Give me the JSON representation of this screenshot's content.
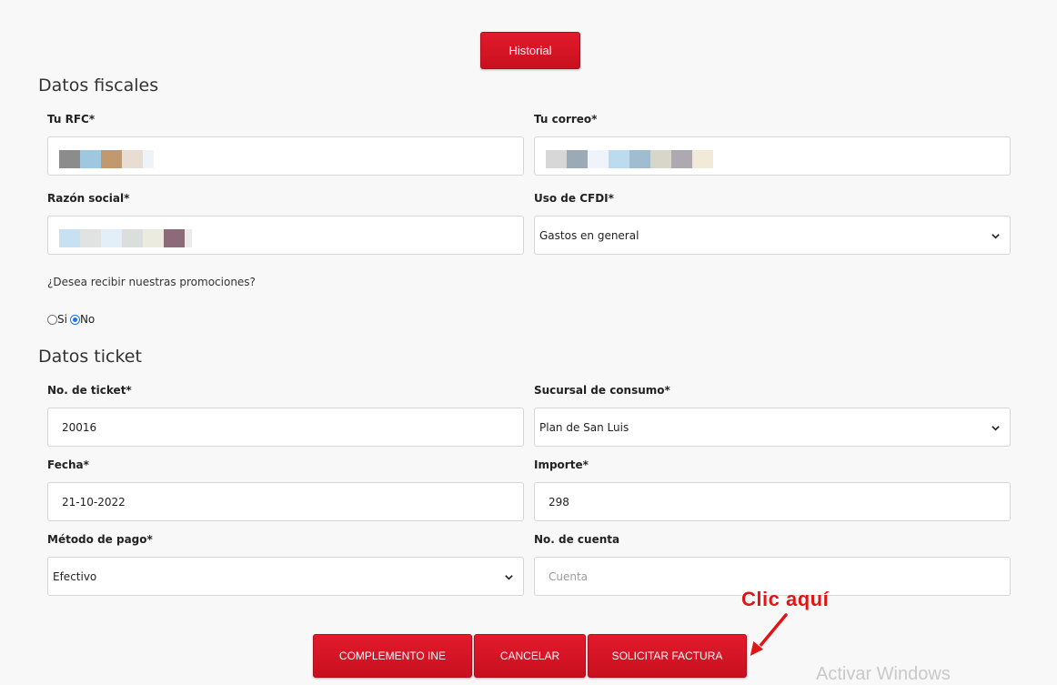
{
  "header": {
    "history_button": "Historial"
  },
  "fiscal": {
    "section_title": "Datos fiscales",
    "rfc": {
      "label": "Tu RFC*"
    },
    "email": {
      "label": "Tu correo*"
    },
    "razon": {
      "label": "Razón social*"
    },
    "cfdi": {
      "label": "Uso de CFDI*",
      "value": "Gastos en general"
    },
    "promo": {
      "question": "¿Desea recibir nuestras promociones?",
      "option_yes": "Si",
      "option_no": "No",
      "selected": "No"
    }
  },
  "ticket": {
    "section_title": "Datos ticket",
    "ticket_no": {
      "label": "No. de ticket*",
      "value": "20016"
    },
    "sucursal": {
      "label": "Sucursal de consumo*",
      "value": "Plan de San Luis"
    },
    "fecha": {
      "label": "Fecha*",
      "value": "21-10-2022"
    },
    "importe": {
      "label": "Importe*",
      "value": "298"
    },
    "metodo": {
      "label": "Método de pago*",
      "value": "Efectivo"
    },
    "cuenta": {
      "label": "No. de cuenta",
      "placeholder": "Cuenta"
    }
  },
  "actions": {
    "complemento": "COMPLEMENTO INE",
    "cancelar": "CANCELAR",
    "solicitar": "SOLICITAR FACTURA"
  },
  "annotation": {
    "text": "Clic aquí"
  },
  "watermark": {
    "text": "Activar Windows"
  },
  "colors": {
    "accent": "#d3131f",
    "annotation": "#e01515",
    "radio": "#1a73e8"
  },
  "icons": {
    "select": "chevron-down-icon",
    "annotation": "red-arrow-icon"
  }
}
